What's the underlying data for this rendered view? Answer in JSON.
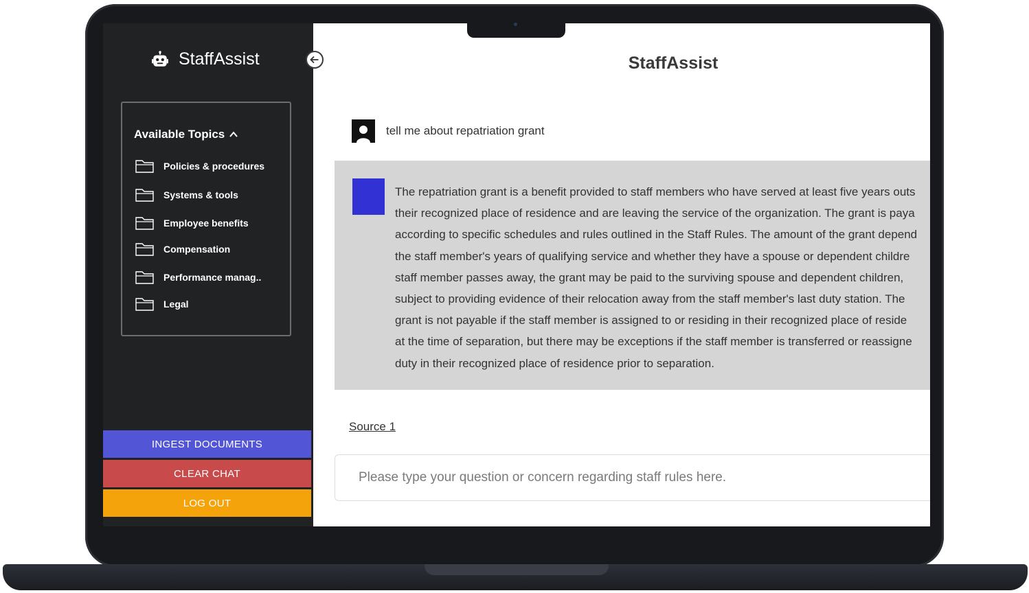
{
  "app": {
    "name": "StaffAssist"
  },
  "sidebar": {
    "topics_title": "Available Topics",
    "topics": [
      {
        "label": "Policies & procedures"
      },
      {
        "label": "Systems & tools"
      },
      {
        "label": "Employee benefits"
      },
      {
        "label": "Compensation"
      },
      {
        "label": "Performance manag.."
      },
      {
        "label": "Legal"
      }
    ],
    "buttons": {
      "ingest": "INGEST DOCUMENTS",
      "clear": "CLEAR CHAT",
      "logout": "LOG OUT"
    }
  },
  "main": {
    "title": "StaffAssist",
    "user_message": "tell me about repatriation grant",
    "bot_message_lines": [
      "The repatriation grant is a benefit provided to staff members who have served at least five years outs",
      "their recognized place of residence and are leaving the service of the organization. The grant is paya",
      "according to specific schedules and rules outlined in the Staff Rules. The amount of the grant depend",
      "the staff member's years of qualifying service and whether they have a spouse or dependent childre",
      "staff member passes away, the grant may be paid to the surviving spouse and dependent children,",
      "subject to providing evidence of their relocation away from the staff member's last duty station. The",
      "grant is not payable if the staff member is assigned to or residing in their recognized place of reside",
      "at the time of separation, but there may be exceptions if the staff member is transferred or reassigne",
      "duty in their recognized place of residence prior to separation."
    ],
    "source_link": "Source 1",
    "input_placeholder": "Please type your question or concern regarding staff rules here."
  },
  "colors": {
    "sidebar_bg": "#212224",
    "ingest": "#5155d6",
    "clear": "#c84a4a",
    "logout": "#f5a30a",
    "bot_avatar": "#3131d4",
    "bot_bubble": "#d5d5d5"
  },
  "icons": {
    "brand": "robot-icon",
    "collapse": "arrow-left-circle-icon",
    "topics_toggle": "chevron-up-icon",
    "topic": "folder-icon",
    "user_avatar": "user-icon"
  }
}
